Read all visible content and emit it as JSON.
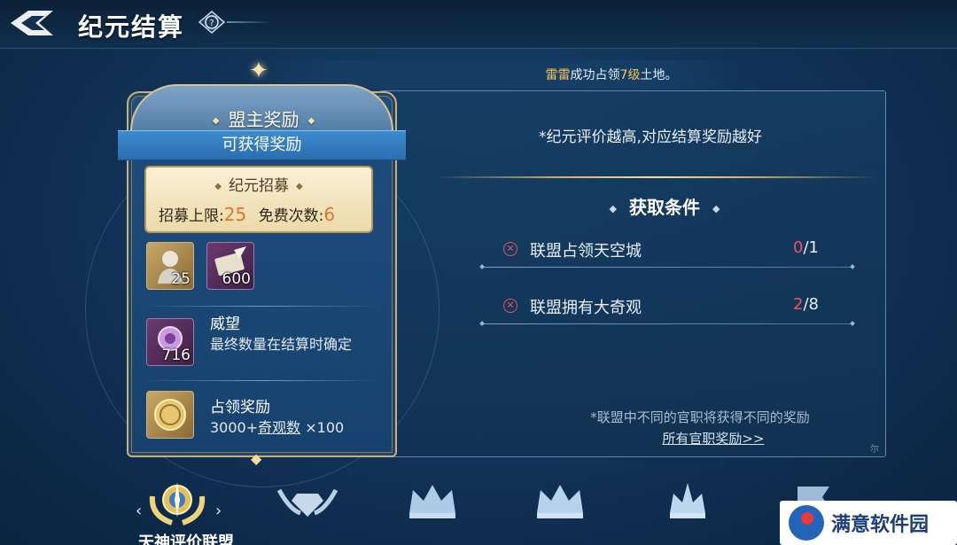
{
  "header": {
    "title": "纪元结算",
    "back_icon": "back-arrow-icon",
    "help_icon": "question-icon"
  },
  "banner": {
    "prefix": "",
    "name": "雷雷",
    "mid": "成功占领",
    "level": "7级",
    "suffix": "土地。"
  },
  "card": {
    "title": "盟主奖励",
    "ribbon": "可获得奖励",
    "recruit": {
      "title": "纪元招募",
      "limit_label": "招募上限:",
      "limit_value": "25",
      "free_label": "免费次数:",
      "free_value": "6"
    },
    "items": [
      {
        "name": "bust",
        "qty": "25"
      },
      {
        "name": "scroll",
        "qty": "600"
      }
    ],
    "prestige": {
      "qty": "716",
      "title": "威望",
      "desc": "最终数量在结算时确定"
    },
    "occupy": {
      "title": "占领奖励",
      "desc_prefix": "3000+",
      "desc_link": "奇观数",
      "desc_suffix": " ×100"
    }
  },
  "main": {
    "hint_top": "*纪元评价越高,对应结算奖励越好",
    "conditions_title": "获取条件",
    "conditions": [
      {
        "label": "联盟占领天空城",
        "current": "0",
        "total": "/1"
      },
      {
        "label": "联盟拥有大奇观",
        "current": "2",
        "total": "/8"
      }
    ],
    "hint_bottom": "*联盟中不同的官职将获得不同的奖励",
    "link_all": "所有官职奖励>>",
    "corner": "尔"
  },
  "tabs": {
    "selected_label": "天神评价联盟",
    "arrow_left": "‹",
    "arrow_right": "›"
  },
  "watermark": {
    "text": "满意软件园"
  },
  "colors": {
    "accent_gold": "#d8b468",
    "highlight": "#f6c35a",
    "fail_red": "#ef5560",
    "ribbon_blue": "#2b6eae"
  }
}
